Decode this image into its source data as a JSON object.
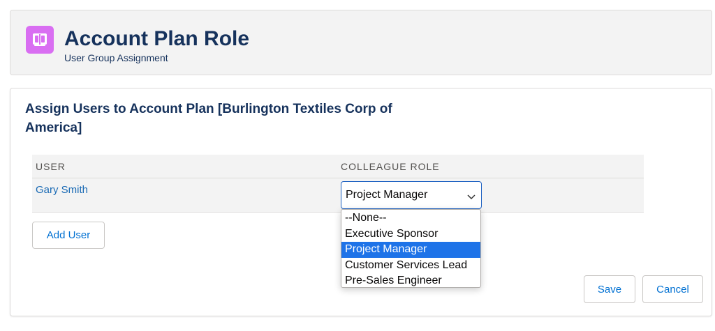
{
  "header": {
    "title": "Account Plan Role",
    "subtitle": "User Group Assignment",
    "icon": "book-icon",
    "icon_color": "#d96ef2"
  },
  "card": {
    "title": "Assign Users to Account Plan [Burlington Textiles Corp of America]"
  },
  "table": {
    "columns": [
      "USER",
      "COLLEAGUE ROLE"
    ],
    "rows": [
      {
        "user": "Gary Smith",
        "role": "Project Manager"
      }
    ]
  },
  "role_dropdown": {
    "selected": "Project Manager",
    "options": [
      "--None--",
      "Executive Sponsor",
      "Project Manager",
      "Customer Services Lead",
      "Pre-Sales Engineer"
    ],
    "highlight_color": "#1e73e8"
  },
  "buttons": {
    "add_user": "Add User",
    "save": "Save",
    "cancel": "Cancel"
  },
  "colors": {
    "title": "#16325c",
    "link": "#1b6bb5",
    "button_text": "#0070d2"
  }
}
